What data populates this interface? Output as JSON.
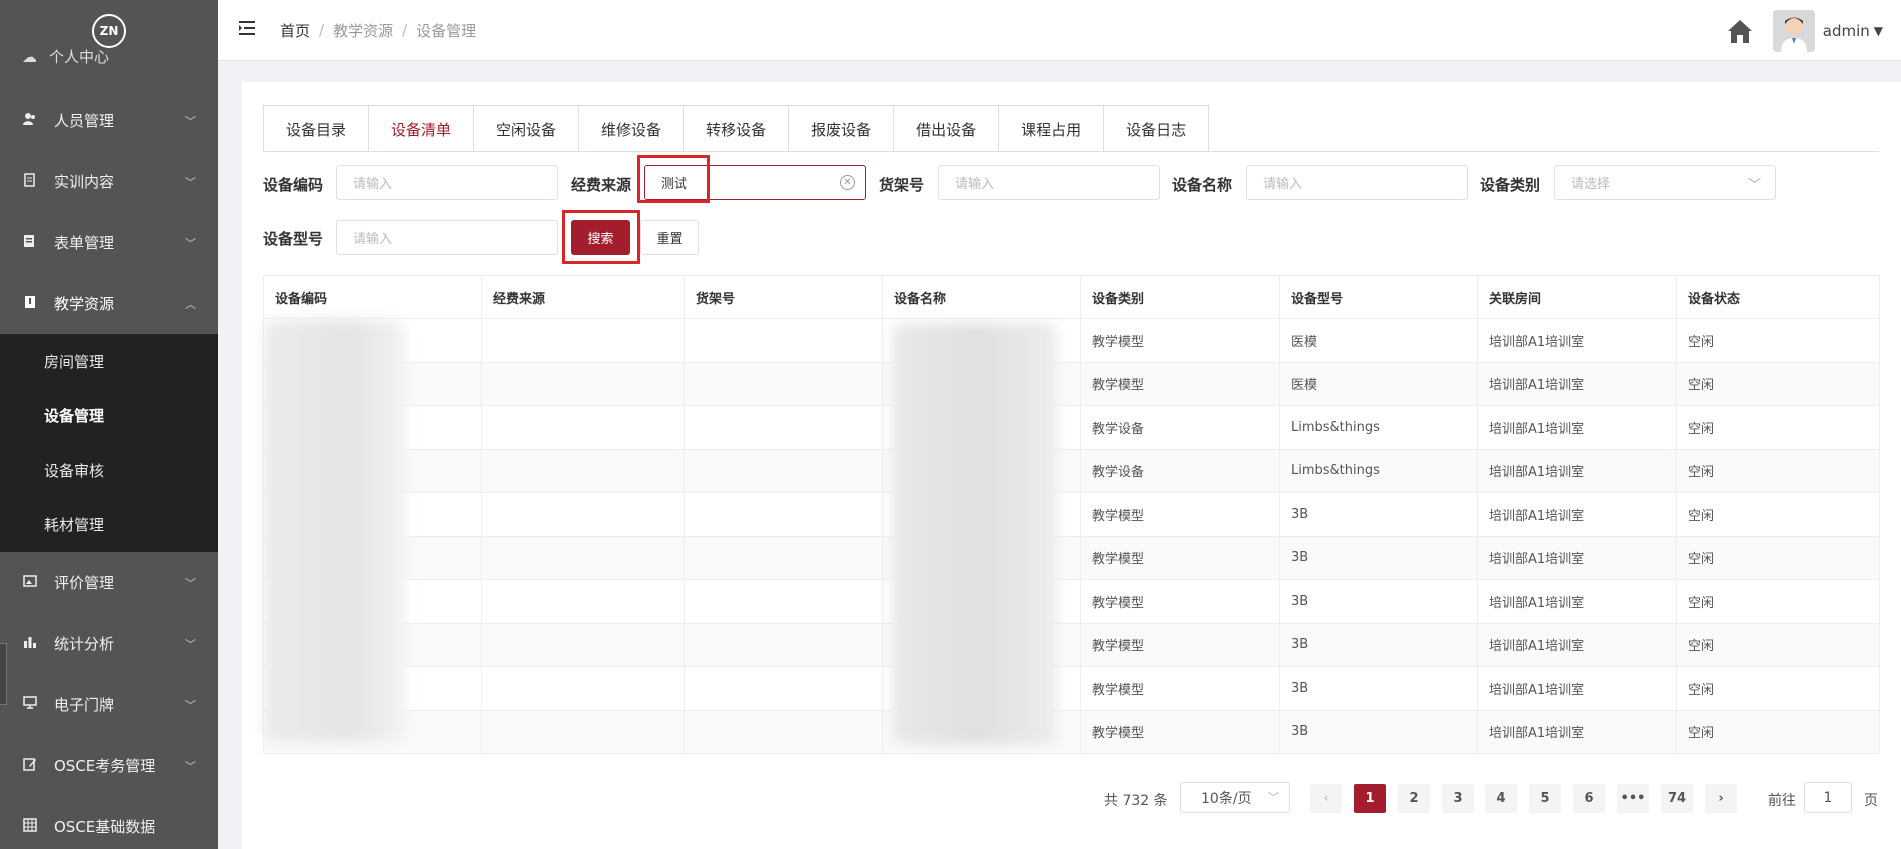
{
  "sidebar": {
    "logo_text": "ZN",
    "cut_item": "个人中心",
    "items": [
      {
        "label": "人员管理",
        "icon": "people-icon"
      },
      {
        "label": "实训内容",
        "icon": "document-icon"
      },
      {
        "label": "表单管理",
        "icon": "form-icon"
      },
      {
        "label": "教学资源",
        "icon": "book-icon",
        "expanded": true,
        "children": [
          "房间管理",
          "设备管理",
          "设备审核",
          "耗材管理"
        ],
        "active_child": "设备管理"
      },
      {
        "label": "评价管理",
        "icon": "image-icon"
      },
      {
        "label": "统计分析",
        "icon": "bar-chart-icon"
      },
      {
        "label": "电子门牌",
        "icon": "monitor-icon"
      },
      {
        "label": "OSCE考务管理",
        "icon": "edit-icon"
      },
      {
        "label": "OSCE基础数据",
        "icon": "grid-icon"
      }
    ]
  },
  "header": {
    "breadcrumb": [
      "首页",
      "教学资源",
      "设备管理"
    ],
    "username": "admin"
  },
  "tabs": [
    "设备目录",
    "设备清单",
    "空闲设备",
    "维修设备",
    "转移设备",
    "报废设备",
    "借出设备",
    "课程占用",
    "设备日志"
  ],
  "active_tab": "设备清单",
  "filters": {
    "code_label": "设备编码",
    "code_placeholder": "请输入",
    "fund_label": "经费来源",
    "fund_value": "测试",
    "shelf_label": "货架号",
    "shelf_placeholder": "请输入",
    "name_label": "设备名称",
    "name_placeholder": "请输入",
    "category_label": "设备类别",
    "category_placeholder": "请选择",
    "model_label": "设备型号",
    "model_placeholder": "请输入",
    "search_label": "搜索",
    "reset_label": "重置"
  },
  "table": {
    "headers": [
      "设备编码",
      "经费来源",
      "货架号",
      "设备名称",
      "设备类别",
      "设备型号",
      "关联房间",
      "设备状态"
    ],
    "rows": [
      {
        "category": "教学模型",
        "model": "医模",
        "room": "培训部A1培训室",
        "status": "空闲"
      },
      {
        "category": "教学模型",
        "model": "医模",
        "room": "培训部A1培训室",
        "status": "空闲"
      },
      {
        "category": "教学设备",
        "model": "Limbs&things",
        "room": "培训部A1培训室",
        "status": "空闲"
      },
      {
        "category": "教学设备",
        "model": "Limbs&things",
        "room": "培训部A1培训室",
        "status": "空闲"
      },
      {
        "category": "教学模型",
        "model": "3B",
        "room": "培训部A1培训室",
        "status": "空闲"
      },
      {
        "category": "教学模型",
        "model": "3B",
        "room": "培训部A1培训室",
        "status": "空闲"
      },
      {
        "category": "教学模型",
        "model": "3B",
        "room": "培训部A1培训室",
        "status": "空闲"
      },
      {
        "category": "教学模型",
        "model": "3B",
        "room": "培训部A1培训室",
        "status": "空闲"
      },
      {
        "category": "教学模型",
        "model": "3B",
        "room": "培训部A1培训室",
        "status": "空闲"
      },
      {
        "category": "教学模型",
        "model": "3B",
        "room": "培训部A1培训室",
        "status": "空闲"
      }
    ]
  },
  "pagination": {
    "total": "共 732 条",
    "page_size": "10条/页",
    "pages": [
      "1",
      "2",
      "3",
      "4",
      "5",
      "6",
      "•••",
      "74"
    ],
    "current": "1",
    "goto_prefix": "前往",
    "goto_value": "1",
    "goto_suffix": "页",
    "prev_icon": "‹",
    "next_icon": "›"
  },
  "colors": {
    "sidebar_bg": "#545454",
    "submenu_bg": "#222222",
    "accent": "#a31d2d",
    "highlight_box": "#d9262c"
  }
}
